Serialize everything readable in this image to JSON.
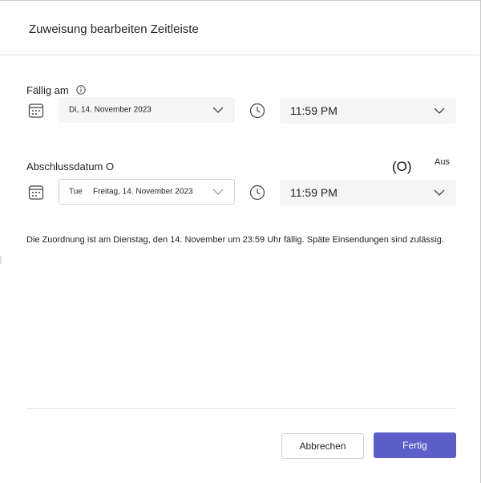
{
  "dialog": {
    "title": "Zuweisung bearbeiten Zeitleiste"
  },
  "due": {
    "label": "Fällig am",
    "date_value": "Di, 14. November 2023",
    "time_value": "11:59 PM"
  },
  "close": {
    "label": "Abschlussdatum O",
    "toggle_state": "(O)",
    "toggle_label": "Aus",
    "date_prefix": "Tue",
    "date_value": "Freitag, 14. November 2023",
    "time_value": "11:59 PM"
  },
  "info_text": "Die Zuordnung ist am Dienstag, den 14. November um 23:59 Uhr fällig. Späte Einsendungen sind zulässig.",
  "buttons": {
    "cancel": "Abbrechen",
    "done": "Fertig"
  },
  "colors": {
    "primary": "#5b5fc7",
    "field_bg": "#f5f5f5",
    "border": "#d1d1d1"
  },
  "icons": [
    "info-icon",
    "calendar-icon",
    "clock-icon",
    "chevron-down-icon"
  ]
}
